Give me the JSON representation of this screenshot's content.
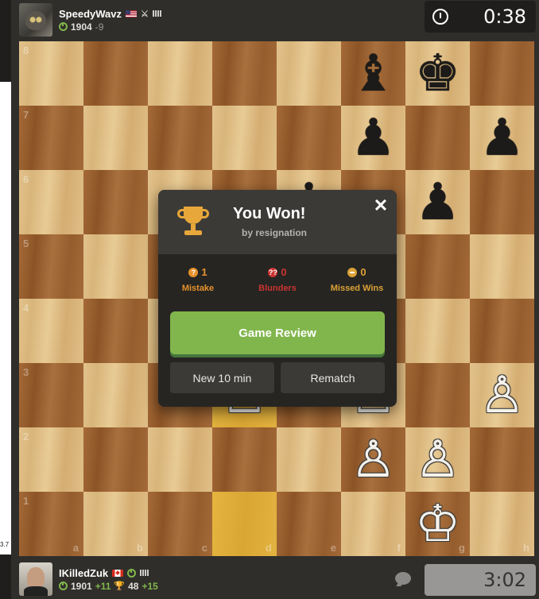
{
  "left_strip": {
    "number": "3.7"
  },
  "top_player": {
    "name": "SpeedyWavz",
    "flag": "us",
    "rating": "1904",
    "rating_delta": "-9"
  },
  "bottom_player": {
    "name": "IKilledZuk",
    "flag": "ca",
    "rating": "1901",
    "rating_delta": "+11",
    "trophy_rating": "48",
    "trophy_delta": "+15"
  },
  "clocks": {
    "top": "0:38",
    "bottom": "3:02"
  },
  "board": {
    "ranks": [
      "8",
      "7",
      "6",
      "5",
      "4",
      "3",
      "2",
      "1"
    ],
    "files": [
      "a",
      "b",
      "c",
      "d",
      "e",
      "f",
      "g",
      "h"
    ],
    "highlight": [
      "d1",
      "d3"
    ],
    "pieces": [
      {
        "square": "f8",
        "glyph": "♝",
        "color": "b",
        "name": "black-bishop"
      },
      {
        "square": "g8",
        "glyph": "♚",
        "color": "b",
        "name": "black-king"
      },
      {
        "square": "f7",
        "glyph": "♟",
        "color": "b",
        "name": "black-pawn"
      },
      {
        "square": "h7",
        "glyph": "♟",
        "color": "b",
        "name": "black-pawn"
      },
      {
        "square": "g6",
        "glyph": "♟",
        "color": "b",
        "name": "black-pawn"
      },
      {
        "square": "e6",
        "glyph": "♟",
        "color": "b",
        "name": "black-pawn"
      },
      {
        "square": "h3",
        "glyph": "♙",
        "color": "w",
        "name": "white-pawn"
      },
      {
        "square": "d3",
        "glyph": "♙",
        "color": "w",
        "name": "white-pawn"
      },
      {
        "square": "f3",
        "glyph": "♙",
        "color": "w",
        "name": "white-pawn"
      },
      {
        "square": "f2",
        "glyph": "♙",
        "color": "w",
        "name": "white-pawn"
      },
      {
        "square": "g2",
        "glyph": "♙",
        "color": "w",
        "name": "white-pawn"
      },
      {
        "square": "g1",
        "glyph": "♔",
        "color": "w",
        "name": "white-king"
      }
    ]
  },
  "modal": {
    "title": "You Won!",
    "subtitle": "by resignation",
    "stats": [
      {
        "count": "1",
        "label": "Mistake",
        "symbol": "?"
      },
      {
        "count": "0",
        "label": "Blunders",
        "symbol": "??"
      },
      {
        "count": "0",
        "label": "Missed Wins",
        "symbol": ""
      }
    ],
    "review_label": "Game Review",
    "new_game_label": "New 10 min",
    "rematch_label": "Rematch"
  },
  "colors": {
    "accent_green": "#81b64c",
    "mistake": "#e6912c",
    "blunder": "#ca3431",
    "missed": "#dba236"
  }
}
